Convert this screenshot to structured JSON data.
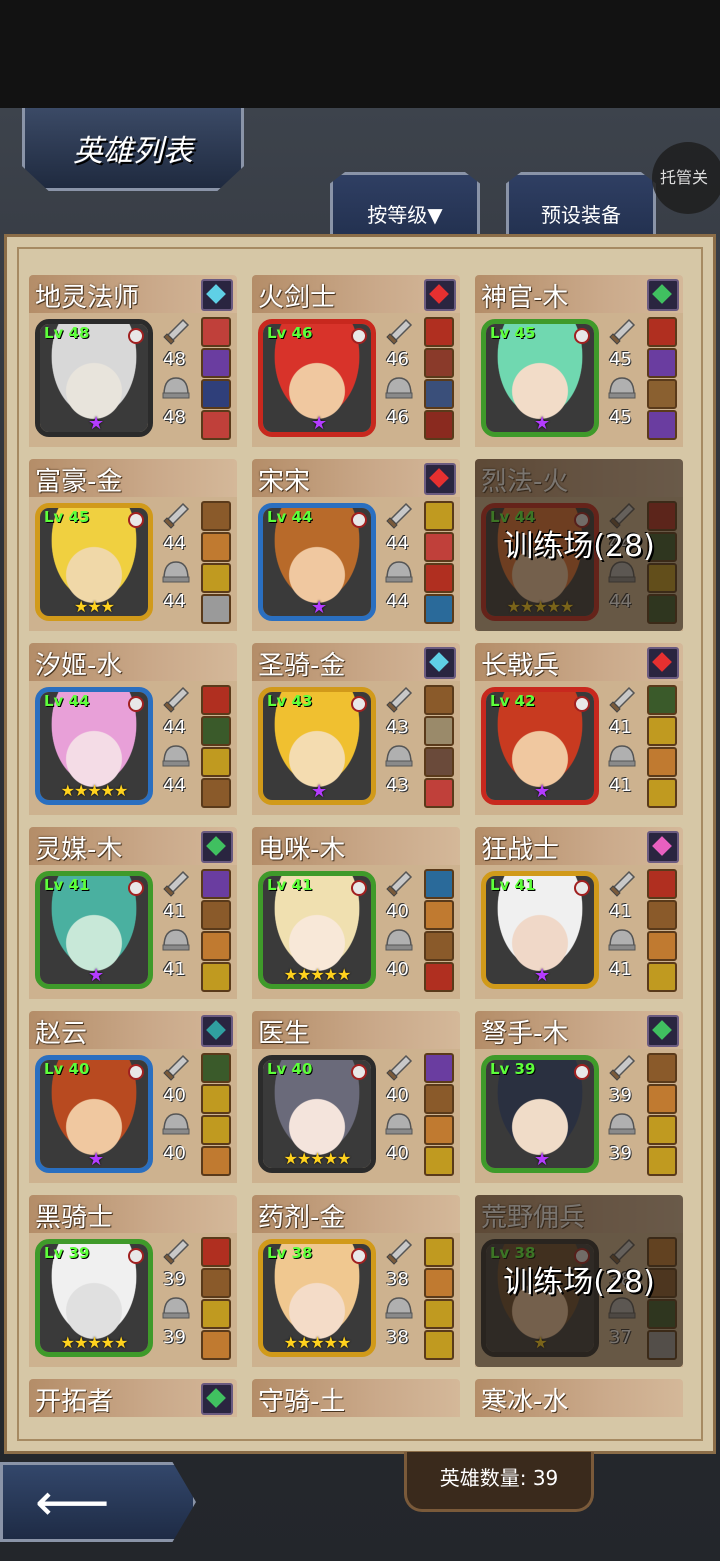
{
  "header": {
    "title": "英雄列表",
    "auto_label": "托管关"
  },
  "tabs": [
    {
      "label": "按等级▼"
    },
    {
      "label": "预设装备"
    }
  ],
  "footer": {
    "hero_count": "英雄数量: 39"
  },
  "colors": {
    "panel": "#d6c7a6",
    "level": "#5dff3a",
    "star": "#ffd21e"
  },
  "heroes": [
    {
      "name": "地灵法师",
      "lv": "Lv 48",
      "atk": "48",
      "def": "48",
      "frame": "#2b2b2b",
      "gem": "#5fd0e6",
      "stars": "★",
      "star_type": "purple",
      "face": "#e8e4dc",
      "hair": "#d8d8d8",
      "equip": [
        "#c0403a",
        "#6a3da0",
        "#2f3f7a",
        "#c0403a"
      ],
      "training": ""
    },
    {
      "name": "火剑士",
      "lv": "Lv 46",
      "atk": "46",
      "def": "46",
      "frame": "#c8281e",
      "gem": "#e63030",
      "stars": "★",
      "star_type": "purple",
      "face": "#f0c8a0",
      "hair": "#d8332a",
      "equip": [
        "#b02f20",
        "#8a3a2a",
        "#3a4f7a",
        "#8a2a1f"
      ],
      "training": ""
    },
    {
      "name": "神官-木",
      "lv": "Lv 45",
      "atk": "45",
      "def": "45",
      "frame": "#3f9a2a",
      "gem": "#40c060",
      "stars": "★",
      "star_type": "purple",
      "face": "#f2dcc8",
      "hair": "#70d8b0",
      "equip": [
        "#b02f20",
        "#6a3da0",
        "#8a6030",
        "#6a3da0"
      ],
      "training": ""
    },
    {
      "name": "富豪-金",
      "lv": "Lv 45",
      "atk": "44",
      "def": "44",
      "frame": "#d19a1a",
      "gem": "",
      "stars": "★★★",
      "star_type": "gold",
      "face": "#f0d8a8",
      "hair": "#f0d040",
      "equip": [
        "#8a5a2a",
        "#c07a30",
        "#c09a20",
        "#9a9a9a"
      ],
      "training": ""
    },
    {
      "name": "宋宋",
      "lv": "Lv 44",
      "atk": "44",
      "def": "44",
      "frame": "#2a6fc0",
      "gem": "#e63030",
      "stars": "★",
      "star_type": "purple",
      "face": "#f0c8a0",
      "hair": "#b86a2a",
      "equip": [
        "#c09a20",
        "#c0403a",
        "#b02f20",
        "#2a6a9a"
      ],
      "training": ""
    },
    {
      "name": "烈法-火",
      "lv": "Lv 44",
      "atk": "44",
      "def": "44",
      "frame": "#c8281e",
      "gem": "",
      "stars": "★★★★★",
      "star_type": "gold",
      "face": "#f0c8a0",
      "hair": "#e07030",
      "equip": [
        "#b02f20",
        "#3a5a2a",
        "#c09a20",
        "#3a5a2a"
      ],
      "training": "训练场(28)"
    },
    {
      "name": "汐姬-水",
      "lv": "Lv 44",
      "atk": "44",
      "def": "44",
      "frame": "#2a6fc0",
      "gem": "",
      "stars": "★★★★★",
      "star_type": "gold",
      "face": "#f4dce6",
      "hair": "#e8a0d8",
      "equip": [
        "#b02f20",
        "#3a5a2a",
        "#c09a20",
        "#8a5a2a"
      ],
      "training": ""
    },
    {
      "name": "圣骑-金",
      "lv": "Lv 43",
      "atk": "43",
      "def": "43",
      "frame": "#d19a1a",
      "gem": "#5fd0e6",
      "stars": "★",
      "star_type": "purple",
      "face": "#f4dcb0",
      "hair": "#f0c030",
      "equip": [
        "#8a5a2a",
        "#9a8a6a",
        "#6a4a3a",
        "#c0403a"
      ],
      "training": ""
    },
    {
      "name": "长戟兵",
      "lv": "Lv 42",
      "atk": "41",
      "def": "41",
      "frame": "#c8281e",
      "gem": "#e63030",
      "stars": "★",
      "star_type": "purple",
      "face": "#f0c8a0",
      "hair": "#c83a20",
      "equip": [
        "#3a5a2a",
        "#c09a20",
        "#c07a30",
        "#c09a20"
      ],
      "training": ""
    },
    {
      "name": "灵媒-木",
      "lv": "Lv 41",
      "atk": "41",
      "def": "41",
      "frame": "#3f9a2a",
      "gem": "#40c060",
      "stars": "★",
      "star_type": "purple",
      "face": "#c8e8d8",
      "hair": "#4ab0a0",
      "equip": [
        "#6a3da0",
        "#8a5a2a",
        "#c07a30",
        "#c09a20"
      ],
      "training": ""
    },
    {
      "name": "电咪-木",
      "lv": "Lv 41",
      "atk": "40",
      "def": "40",
      "frame": "#3f9a2a",
      "gem": "",
      "stars": "★★★★★",
      "star_type": "gold",
      "face": "#f8e8d8",
      "hair": "#f0e0b0",
      "equip": [
        "#2a6a9a",
        "#c07a30",
        "#8a5a2a",
        "#b02f20"
      ],
      "training": ""
    },
    {
      "name": "狂战士",
      "lv": "Lv 41",
      "atk": "41",
      "def": "41",
      "frame": "#d19a1a",
      "gem": "#e860c0",
      "stars": "★",
      "star_type": "purple",
      "face": "#f0d8c8",
      "hair": "#f0f0f0",
      "equip": [
        "#b02f20",
        "#8a5a2a",
        "#c07a30",
        "#c09a20"
      ],
      "training": ""
    },
    {
      "name": "赵云",
      "lv": "Lv 40",
      "atk": "40",
      "def": "40",
      "frame": "#2a6fc0",
      "gem": "#30a0a0",
      "stars": "★",
      "star_type": "purple",
      "face": "#f0c8a0",
      "hair": "#b84a20",
      "equip": [
        "#3a5a2a",
        "#c09a20",
        "#c09a20",
        "#c07a30"
      ],
      "training": ""
    },
    {
      "name": "医生",
      "lv": "Lv 40",
      "atk": "40",
      "def": "40",
      "frame": "#2b2b2b",
      "gem": "",
      "stars": "★★★★★",
      "star_type": "gold",
      "face": "#f4e4dc",
      "hair": "#6a6a7a",
      "equip": [
        "#6a3da0",
        "#8a5a2a",
        "#c07a30",
        "#c09a20"
      ],
      "training": ""
    },
    {
      "name": "弩手-木",
      "lv": "Lv 39",
      "atk": "39",
      "def": "39",
      "frame": "#3f9a2a",
      "gem": "#40c060",
      "stars": "★",
      "star_type": "purple",
      "face": "#f0dcc8",
      "hair": "#2a3040",
      "equip": [
        "#8a5a2a",
        "#c07a30",
        "#c09a20",
        "#c09a20"
      ],
      "training": ""
    },
    {
      "name": "黑骑士",
      "lv": "Lv 39",
      "atk": "39",
      "def": "39",
      "frame": "#3f9a2a",
      "gem": "",
      "stars": "★★★★★",
      "star_type": "gold",
      "face": "#e0e0e0",
      "hair": "#f0f0f0",
      "equip": [
        "#b02f20",
        "#8a5a2a",
        "#c09a20",
        "#c07a30"
      ],
      "training": ""
    },
    {
      "name": "药剂-金",
      "lv": "Lv 38",
      "atk": "38",
      "def": "38",
      "frame": "#d19a1a",
      "gem": "",
      "stars": "★★★★★",
      "star_type": "gold",
      "face": "#f4dcc8",
      "hair": "#f0c890",
      "equip": [
        "#c09a20",
        "#c07a30",
        "#c09a20",
        "#c09a20"
      ],
      "training": ""
    },
    {
      "name": "荒野佣兵",
      "lv": "Lv 38",
      "atk": "38",
      "def": "37",
      "frame": "#2b2b2b",
      "gem": "",
      "stars": "★",
      "star_type": "gold",
      "face": "#f0c8a0",
      "hair": "#6a4a2a",
      "equip": [
        "#c07a30",
        "#8a5a2a",
        "#3a5a2a",
        "#9a9a9a"
      ],
      "training": "训练场(28)"
    }
  ],
  "partial_heroes": [
    {
      "name": "开拓者",
      "gem": "#40c060"
    },
    {
      "name": "守骑-土",
      "gem": ""
    },
    {
      "name": "寒冰-水",
      "gem": ""
    }
  ]
}
